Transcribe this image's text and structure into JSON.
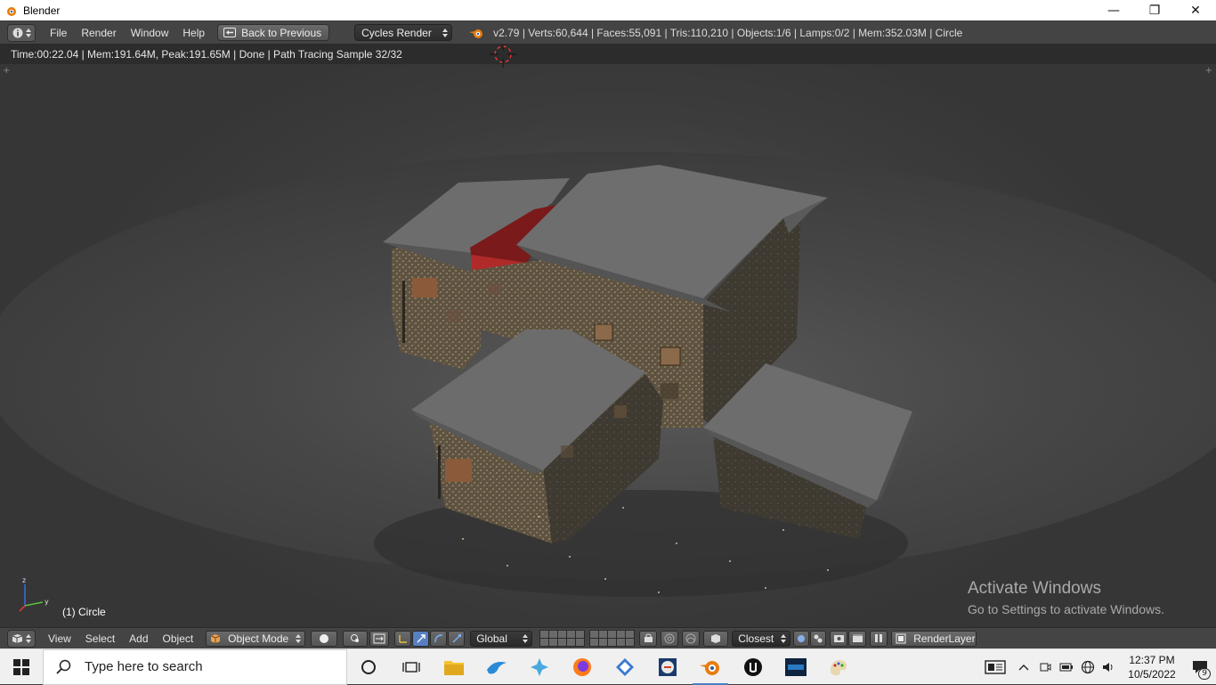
{
  "window": {
    "title": "Blender"
  },
  "infobar": {
    "menus": [
      "File",
      "Render",
      "Window",
      "Help"
    ],
    "back_label": "Back to Previous",
    "render_engine": "Cycles Render",
    "stats": "v2.79 | Verts:60,644 | Faces:55,091 | Tris:110,210 | Objects:1/6 | Lamps:0/2 | Mem:352.03M | Circle"
  },
  "viewport": {
    "render_status": "Time:00:22.04 | Mem:191.64M, Peak:191.65M | Done | Path Tracing Sample 32/32",
    "object_label": "(1) Circle",
    "watermark_title": "Activate Windows",
    "watermark_sub": "Go to Settings to activate Windows."
  },
  "header3d": {
    "menus": [
      "View",
      "Select",
      "Add",
      "Object"
    ],
    "mode": "Object Mode",
    "orientation": "Global",
    "snap_target": "Closest",
    "render_layer": "RenderLayer"
  },
  "taskbar": {
    "search_placeholder": "Type here to search",
    "time": "12:37 PM",
    "date": "10/5/2022",
    "notification_count": "9"
  }
}
